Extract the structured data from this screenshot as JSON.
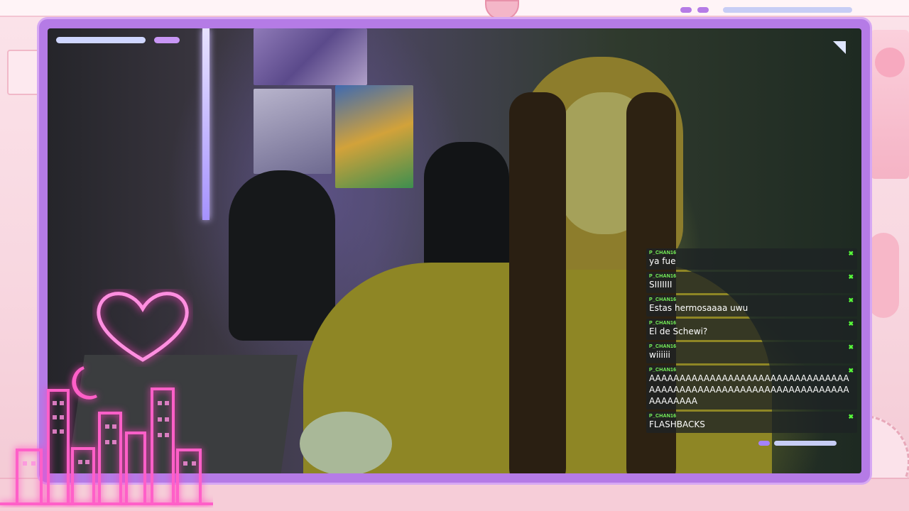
{
  "overlay": {
    "colors": {
      "frame": "#b57be6",
      "neon_pink": "#ff5fc8",
      "chat_username": "#7cff5d",
      "chat_text": "#ffffff",
      "chat_bg": "rgba(30,34,36,0.78)"
    },
    "icons": [
      "heart-neon-icon",
      "moon-neon-icon",
      "city-skyline-neon-icon",
      "check-badge-icon"
    ]
  },
  "chat": {
    "messages": [
      {
        "user": "P_CHAN16",
        "text": "ya fue",
        "badge": "✖"
      },
      {
        "user": "P_CHAN16",
        "text": "SIIIIIII",
        "badge": "✖"
      },
      {
        "user": "P_CHAN16",
        "text": "Estas hermosaaaa uwu",
        "badge": "✖"
      },
      {
        "user": "P_CHAN16",
        "text": "El de Schewi?",
        "badge": "✖"
      },
      {
        "user": "P_CHAN16",
        "text": "wiiiiii",
        "badge": "✖"
      },
      {
        "user": "P_CHAN16",
        "text": "AAAAAAAAAAAAAAAAAAAAAAAAAAAAAAAAAAAAAAAAAAAAAAAAAAAAAAAAAAAAAAAAAAAAAAAAAA",
        "badge": "✖"
      },
      {
        "user": "P_CHAN16",
        "text": "FLASHBACKS",
        "badge": "✖"
      }
    ]
  }
}
